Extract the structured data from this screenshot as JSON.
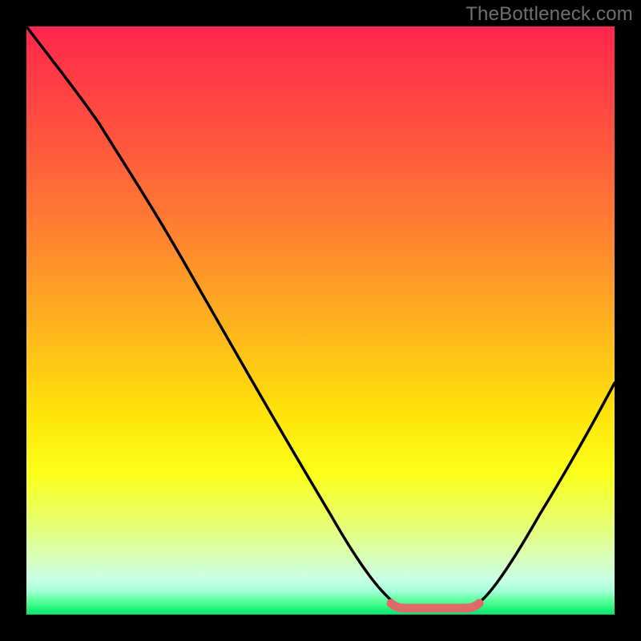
{
  "attribution": "TheBottleneck.com",
  "colors": {
    "page_bg": "#000000",
    "gradient_stops": [
      "#ff254e",
      "#ff5c3c",
      "#ff8b2d",
      "#ffb71c",
      "#ffe40a",
      "#fbff1a",
      "#e8ff6a",
      "#c8ffe6",
      "#00e56a"
    ],
    "curve": "#000000",
    "highlight": "#e06a6a"
  },
  "chart_data": {
    "type": "line",
    "title": "",
    "xlabel": "",
    "ylabel": "",
    "xlim": [
      0,
      100
    ],
    "ylim": [
      0,
      100
    ],
    "series": [
      {
        "name": "bottleneck-curve",
        "x": [
          0,
          5,
          10,
          15,
          20,
          25,
          30,
          35,
          40,
          45,
          50,
          55,
          60,
          65,
          70,
          75,
          80,
          85,
          90,
          95,
          100
        ],
        "y": [
          100,
          92,
          85,
          78,
          71,
          63,
          55,
          47,
          39,
          31,
          23,
          15,
          6,
          2,
          0,
          0,
          1,
          8,
          17,
          26,
          35
        ]
      }
    ],
    "annotations": [
      {
        "name": "optimal-flat-segment",
        "x_range": [
          62,
          76
        ],
        "y": 0.6,
        "note": "highlighted pink flat bottom"
      }
    ],
    "background": {
      "type": "vertical-gradient",
      "meaning": "green = no bottleneck, red = severe bottleneck"
    }
  }
}
